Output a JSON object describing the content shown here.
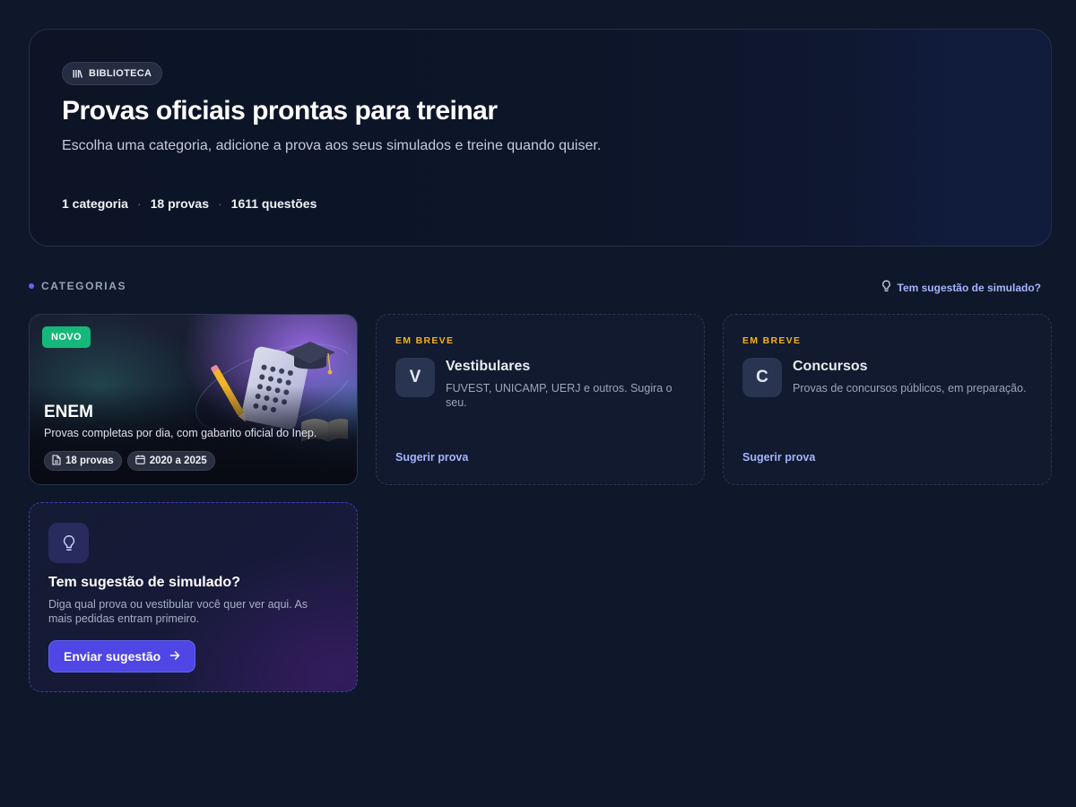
{
  "hero": {
    "badge": "BIBLIOTECA",
    "badge_icon": "library-icon",
    "title": "Provas oficiais prontas para treinar",
    "subtitle": "Escolha uma categoria, adicione a prova aos seus simulados e treine quando quiser.",
    "stats": [
      "1 categoria",
      "18 provas",
      "1611 questões"
    ],
    "separator": "·"
  },
  "section": {
    "label": "CATEGORIAS",
    "suggest_link": "Tem sugestão de simulado?",
    "suggest_icon": "lightbulb-icon"
  },
  "categories": {
    "enem": {
      "badge": "NOVO",
      "title": "ENEM",
      "description": "Provas completas por dia, com gabarito oficial do Inep.",
      "chips": [
        {
          "icon": "document-icon",
          "label": "18 provas"
        },
        {
          "icon": "calendar-icon",
          "label": "2020 a 2025"
        }
      ]
    },
    "soon": [
      {
        "tag": "EM BREVE",
        "letter": "V",
        "title": "Vestibulares",
        "description": "FUVEST, UNICAMP, UERJ e outros. Sugira o seu.",
        "link": "Sugerir prova"
      },
      {
        "tag": "EM BREVE",
        "letter": "C",
        "title": "Concursos",
        "description": "Provas de concursos públicos, em preparação.",
        "link": "Sugerir prova"
      }
    ]
  },
  "suggestion_card": {
    "icon": "lightbulb-icon",
    "title": "Tem sugestão de simulado?",
    "description": "Diga qual prova ou vestibular você quer ver aqui. As mais pedidas entram primeiro.",
    "button": "Enviar sugestão",
    "button_icon": "arrow-right-icon"
  },
  "colors": {
    "background": "#0f172a",
    "accent": "#4f46e5",
    "link": "#a5b4fc",
    "new_badge": "#16b77a",
    "coming_soon": "#f5b21b"
  }
}
